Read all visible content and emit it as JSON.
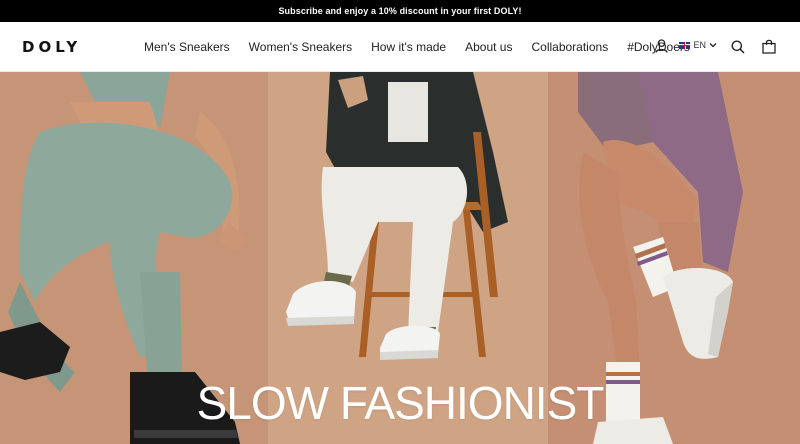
{
  "announcement": {
    "text": "Subscribe and enjoy a 10% discount in your first DOLY!"
  },
  "header": {
    "logo": "DOLY",
    "nav": [
      {
        "label": "Men's Sneakers"
      },
      {
        "label": "Women's Sneakers"
      },
      {
        "label": "How it's made"
      },
      {
        "label": "About us"
      },
      {
        "label": "Collaborations"
      },
      {
        "label": "#DolyDoers"
      }
    ],
    "language": {
      "code": "EN",
      "flag_icon": "uk-flag-icon"
    },
    "icons": [
      "account-icon",
      "search-icon",
      "cart-icon"
    ]
  },
  "hero": {
    "title": "SLOW FASHIONIST",
    "colors": {
      "background": "#c99b78",
      "title": "#ffffff"
    }
  }
}
